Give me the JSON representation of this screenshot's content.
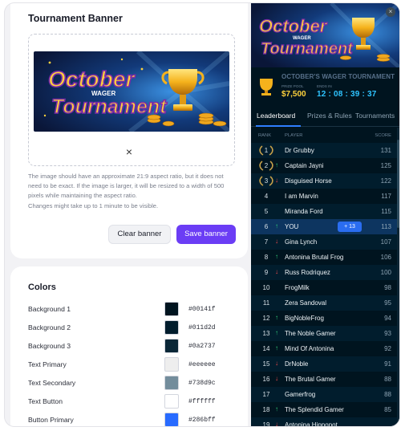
{
  "banner_section": {
    "title": "Tournament Banner",
    "remove_label": "×",
    "banner_art": {
      "line1": "October",
      "line2": "WAGER",
      "line3": "Tournament"
    },
    "help_text": "The image should have an approximate 21:9 aspect ratio, but it does not need to be exact. If the image is larger, it will be resized to a width of 500 pixels while maintaining the aspect ratio.",
    "help_text2": "Changes might take up to 1 minute to be visible.",
    "clear_label": "Clear banner",
    "save_label": "Save banner"
  },
  "colors_section": {
    "title": "Colors",
    "items": [
      {
        "label": "Background 1",
        "hex": "#00141f"
      },
      {
        "label": "Background 2",
        "hex": "#011d2d"
      },
      {
        "label": "Background 3",
        "hex": "#0a2737"
      },
      {
        "label": "Text Primary",
        "hex": "#eeeeee"
      },
      {
        "label": "Text Secondary",
        "hex": "#738d9c"
      },
      {
        "label": "Text Button",
        "hex": "#ffffff"
      },
      {
        "label": "Button Primary",
        "hex": "#286bff"
      }
    ]
  },
  "widget": {
    "close_label": "×",
    "hero": {
      "line1": "October",
      "line2": "WAGER",
      "line3": "Tournament"
    },
    "event_title": "OCTOBER'S WAGER TOURNAMENT",
    "prize_pool_label": "PRIZE POOL",
    "prize_pool": "$7,500",
    "ends_in_label": "ENDS IN",
    "timer": "12 : 08 : 39 : 37",
    "tabs": [
      "Leaderboard",
      "Prizes & Rules",
      "Tournaments"
    ],
    "columns": {
      "rank": "RANK",
      "player": "PLAYER",
      "score": "SCORE"
    },
    "rows": [
      {
        "rank": "1",
        "trend": "none",
        "name": "Dr Grubby",
        "score": "131",
        "laurel": true
      },
      {
        "rank": "2",
        "trend": "up",
        "name": "Captain Jayni",
        "score": "125",
        "laurel": true
      },
      {
        "rank": "3",
        "trend": "down",
        "name": "Disguised Horse",
        "score": "122",
        "laurel": true
      },
      {
        "rank": "4",
        "trend": "none",
        "name": "I am Marvin",
        "score": "117"
      },
      {
        "rank": "5",
        "trend": "none",
        "name": "Miranda Ford",
        "score": "115"
      },
      {
        "rank": "6",
        "trend": "up",
        "name": "YOU",
        "score": "113",
        "highlight": true,
        "change": "+ 13"
      },
      {
        "rank": "7",
        "trend": "down",
        "name": "Gina Lynch",
        "score": "107"
      },
      {
        "rank": "8",
        "trend": "up",
        "name": "Antonina Brutal Frog",
        "score": "106"
      },
      {
        "rank": "9",
        "trend": "down",
        "name": "Russ Rodriquez",
        "score": "100"
      },
      {
        "rank": "10",
        "trend": "none",
        "name": "FrogMilk",
        "score": "98"
      },
      {
        "rank": "11",
        "trend": "none",
        "name": "Zera Sandoval",
        "score": "95"
      },
      {
        "rank": "12",
        "trend": "up",
        "name": "BigNobleFrog",
        "score": "94"
      },
      {
        "rank": "13",
        "trend": "up",
        "name": "The Noble Gamer",
        "score": "93"
      },
      {
        "rank": "14",
        "trend": "up",
        "name": "Mind Of Antonina",
        "score": "92"
      },
      {
        "rank": "15",
        "trend": "down",
        "name": "DrNoble",
        "score": "91"
      },
      {
        "rank": "16",
        "trend": "down",
        "name": "The Brutal Gamer",
        "score": "88"
      },
      {
        "rank": "17",
        "trend": "none",
        "name": "Gamerfrog",
        "score": "88"
      },
      {
        "rank": "18",
        "trend": "up",
        "name": "The Splendid Gamer",
        "score": "85"
      },
      {
        "rank": "19",
        "trend": "down",
        "name": "Antonina Hippopot…",
        "score": ""
      }
    ]
  }
}
